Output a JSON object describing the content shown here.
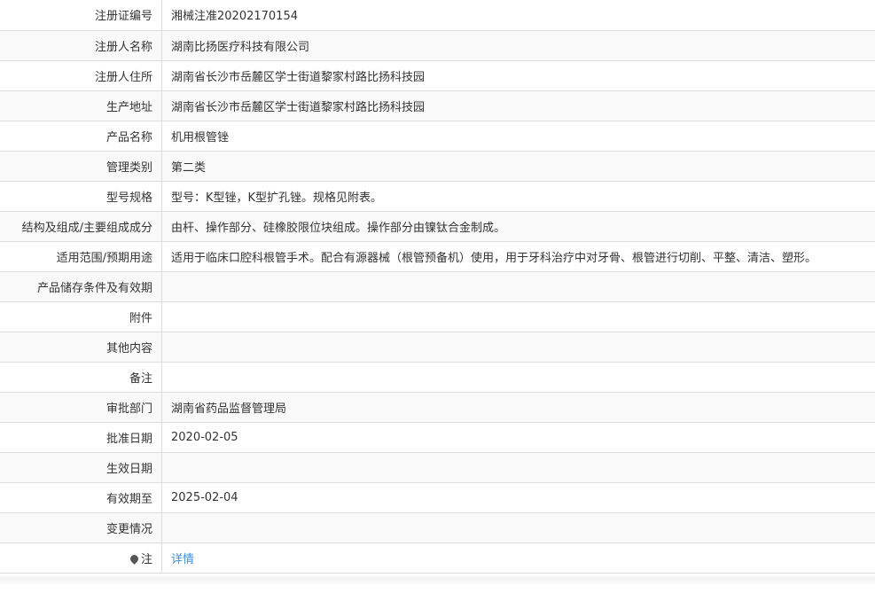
{
  "rows": [
    {
      "label": "注册证编号",
      "value": "湘械注准20202170154"
    },
    {
      "label": "注册人名称",
      "value": "湖南比扬医疗科技有限公司"
    },
    {
      "label": "注册人住所",
      "value": "湖南省长沙市岳麓区学士街道黎家村路比扬科技园"
    },
    {
      "label": "生产地址",
      "value": "湖南省长沙市岳麓区学士街道黎家村路比扬科技园"
    },
    {
      "label": "产品名称",
      "value": "机用根管锉"
    },
    {
      "label": "管理类别",
      "value": "第二类"
    },
    {
      "label": "型号规格",
      "value": "型号：K型锉，K型扩孔锉。规格见附表。"
    },
    {
      "label": "结构及组成/主要组成成分",
      "value": "由杆、操作部分、硅橡胶限位块组成。操作部分由镍钛合金制成。"
    },
    {
      "label": "适用范围/预期用途",
      "value": "适用于临床口腔科根管手术。配合有源器械（根管预备机）使用，用于牙科治疗中对牙骨、根管进行切削、平整、清洁、塑形。"
    },
    {
      "label": "产品储存条件及有效期",
      "value": ""
    },
    {
      "label": "附件",
      "value": ""
    },
    {
      "label": "其他内容",
      "value": ""
    },
    {
      "label": "备注",
      "value": ""
    },
    {
      "label": "审批部门",
      "value": "湖南省药品监督管理局"
    },
    {
      "label": "批准日期",
      "value": "2020-02-05"
    },
    {
      "label": "生效日期",
      "value": ""
    },
    {
      "label": "有效期至",
      "value": "2025-02-04"
    },
    {
      "label": "变更情况",
      "value": ""
    }
  ],
  "note": {
    "label": "注",
    "icon": "map-pin-icon",
    "link_text": "详情",
    "link_color": "#3a8fe0"
  }
}
